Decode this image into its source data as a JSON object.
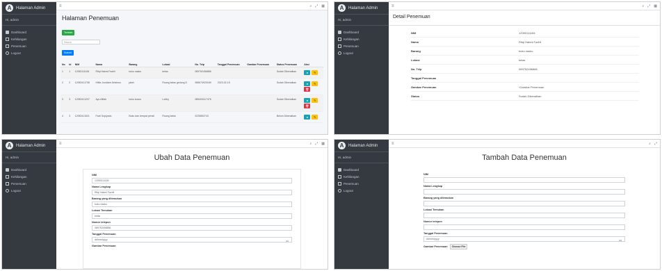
{
  "brand": "Halaman Admin",
  "user": "Hi, admin",
  "nav": [
    "Dashboard",
    "Kehilangan",
    "Penemuan",
    "Logout"
  ],
  "list": {
    "title": "Halaman Penemuan",
    "add_button": "Tambah",
    "search_placeholder": "Search",
    "search_button": "Submit",
    "headers": [
      "No",
      "Id",
      "NIM",
      "Nama",
      "Barang",
      "Lokasi",
      "No. Telp",
      "Tanggal Penemuan",
      "Gambar Penemuan",
      "Status Penemuan",
      "Aksi"
    ],
    "rows": [
      [
        "1",
        "1",
        "12050111184",
        "Rifqi Hakmi Fazhil",
        "buku nasko",
        "kelas",
        "089752456886",
        "",
        "",
        "Sudah Dikenalkan"
      ],
      [
        "2",
        "2",
        "12050411708",
        "Hilfia Jondiare Almimus",
        "jaket",
        "Ruang kelas gedung D",
        "085674920189",
        "2023-02-15",
        "",
        "Sudah Dikenalkan"
      ],
      [
        "3",
        "3",
        "12050411207",
        "Ayu Afifah",
        "buku kosos",
        "Lobby",
        "085493417476",
        "",
        "",
        "Sudah Dikenalkan"
      ],
      [
        "4",
        "3",
        "12050411521",
        "Fazil Sopiyadu",
        "Buku dan tempat pensil",
        "Ruang kelas",
        "0225853743",
        "",
        "",
        "Belum Dikenalkan"
      ]
    ]
  },
  "detail": {
    "title": "Detail Penemuan",
    "rows": [
      {
        "label": "NIM",
        "value": "12050111184"
      },
      {
        "label": "Nama",
        "value": "Rifqi Hakmi Fazhil"
      },
      {
        "label": "Barang",
        "value": "buku nasko"
      },
      {
        "label": "Lokasi",
        "value": "kelas"
      },
      {
        "label": "No. Telp",
        "value": "089752456886"
      },
      {
        "label": "Tanggal Penemuan",
        "value": ""
      },
      {
        "label": "Gambar Penemuan",
        "value": "Gambar Penemuan"
      },
      {
        "label": "Status",
        "value": "Sudah Dikenalkan"
      }
    ]
  },
  "edit": {
    "title": "Ubah Data Penemuan",
    "fields": [
      {
        "label": "NIM",
        "value": "12050111184"
      },
      {
        "label": "Nama Lengkap",
        "value": "Rifqi Hakmi Fazhil"
      },
      {
        "label": "Barang yang ditemukan",
        "value": "buku nasko"
      },
      {
        "label": "Lokasi Temukan",
        "value": "kelas"
      },
      {
        "label": "Nomor telepon",
        "value": "089752456886"
      },
      {
        "label": "Tanggal Penemuan",
        "value": "dd/mm/yyyy"
      },
      {
        "label": "Gambar Penemuan",
        "value": ""
      }
    ]
  },
  "add": {
    "title": "Tambah Data Penemuan",
    "fields": [
      {
        "label": "NIM",
        "value": ""
      },
      {
        "label": "Nama Lengkap",
        "value": ""
      },
      {
        "label": "Barang yang ditemukan",
        "value": ""
      },
      {
        "label": "Lokasi Temukan",
        "value": ""
      },
      {
        "label": "Nomor telepon",
        "value": ""
      },
      {
        "label": "Tanggal Penemuan",
        "value": "dd/mm/yyyy"
      }
    ],
    "image_label": "Gambar Penemuan",
    "image_button": "Choose File"
  },
  "topbar_icons": [
    "search-icon",
    "expand-icon",
    "grid-icon"
  ]
}
